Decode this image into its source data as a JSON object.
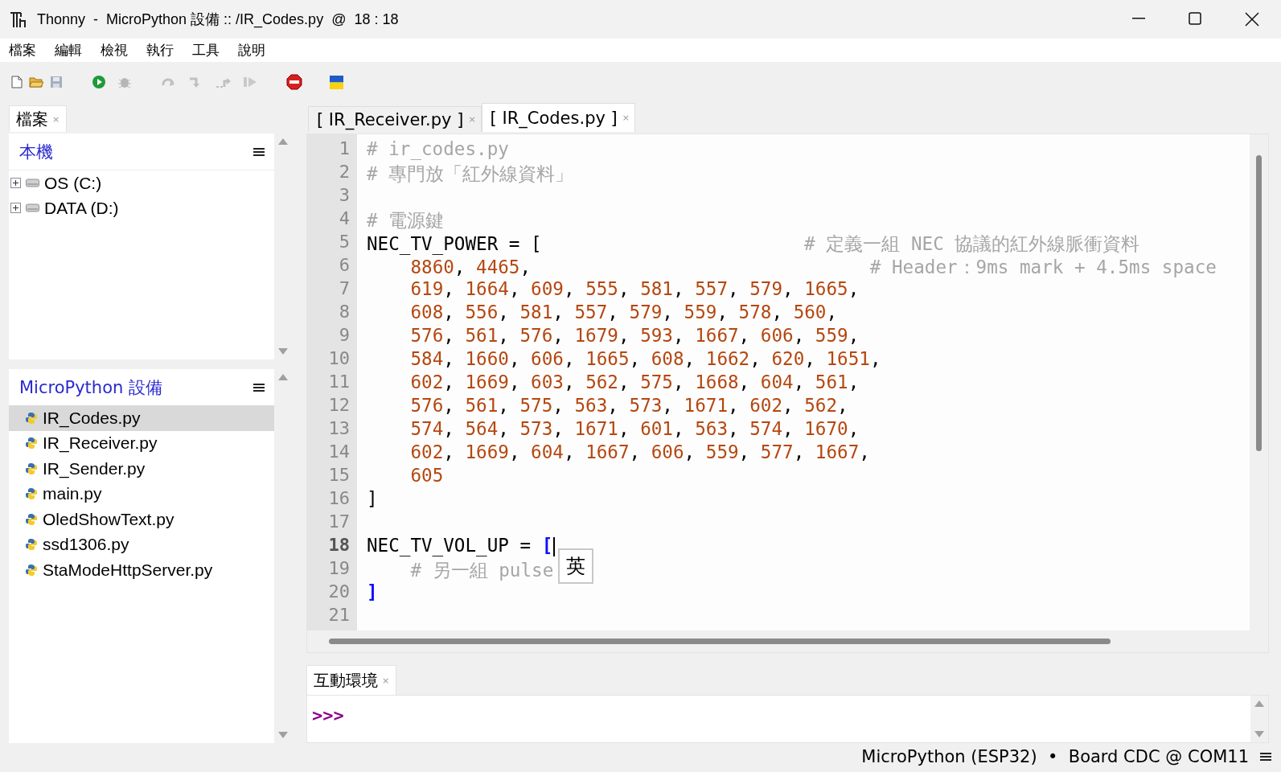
{
  "window": {
    "title": "Thonny  -  MicroPython 設備 :: /IR_Codes.py  @  18 : 18"
  },
  "menu": [
    "檔案",
    "編輯",
    "檢視",
    "執行",
    "工具",
    "說明"
  ],
  "toolbar": [
    {
      "kind": "new",
      "disabled": false
    },
    {
      "kind": "open",
      "disabled": false
    },
    {
      "kind": "save",
      "disabled": true
    },
    {
      "kind": "run",
      "disabled": false
    },
    {
      "kind": "debug",
      "disabled": true
    },
    {
      "kind": "step-over",
      "disabled": true
    },
    {
      "kind": "step-into",
      "disabled": true
    },
    {
      "kind": "step-out",
      "disabled": true
    },
    {
      "kind": "resume",
      "disabled": true
    },
    {
      "kind": "stop",
      "disabled": false
    },
    {
      "kind": "flag",
      "disabled": false
    }
  ],
  "sidebar": {
    "tab": {
      "label": "檔案",
      "close": "×"
    },
    "local": {
      "title": "本機",
      "items": [
        {
          "label": "OS (C:)",
          "expanded": false
        },
        {
          "label": "DATA (D:)",
          "expanded": false
        }
      ]
    },
    "device": {
      "title": "MicroPython 設備",
      "items": [
        {
          "label": "IR_Codes.py",
          "selected": true
        },
        {
          "label": "IR_Receiver.py",
          "selected": false
        },
        {
          "label": "IR_Sender.py",
          "selected": false
        },
        {
          "label": "main.py",
          "selected": false
        },
        {
          "label": "OledShowText.py",
          "selected": false
        },
        {
          "label": "ssd1306.py",
          "selected": false
        },
        {
          "label": "StaModeHttpServer.py",
          "selected": false
        }
      ]
    }
  },
  "editor": {
    "tabs": [
      {
        "label": "[ IR_Receiver.py ]",
        "close": "×",
        "selected": false
      },
      {
        "label": "[ IR_Codes.py ]",
        "close": "×",
        "selected": true
      }
    ],
    "lines": [
      {
        "number": "1",
        "current": false,
        "tokens": [
          {
            "kind": "comment",
            "text": "# ir_codes.py"
          }
        ]
      },
      {
        "number": "2",
        "current": false,
        "tokens": [
          {
            "kind": "comment",
            "text": "# 專門放「紅外線資料」"
          }
        ]
      },
      {
        "number": "3",
        "current": false
      },
      {
        "number": "4",
        "current": false,
        "tokens": [
          {
            "kind": "comment",
            "text": "# 電源鍵"
          }
        ]
      },
      {
        "number": "5",
        "current": false,
        "tokens": [
          {
            "kind": "plain",
            "text": "NEC_TV_POWER = ["
          },
          {
            "kind": "comment",
            "text": "                        # 定義一組 NEC 協議的紅外線脈衝資料"
          }
        ]
      },
      {
        "number": "6",
        "current": false,
        "tokens": [
          {
            "kind": "numbers",
            "text": "    8860, 4465,"
          },
          {
            "kind": "comment",
            "text": "                               # Header：9ms mark + 4.5ms space"
          }
        ]
      },
      {
        "number": "7",
        "current": false,
        "tokens": [
          {
            "kind": "numbers",
            "text": "    619, 1664, 609, 555, 581, 557, 579, 1665,"
          }
        ]
      },
      {
        "number": "8",
        "current": false,
        "tokens": [
          {
            "kind": "numbers",
            "text": "    608, 556, 581, 557, 579, 559, 578, 560,"
          }
        ]
      },
      {
        "number": "9",
        "current": false,
        "tokens": [
          {
            "kind": "numbers",
            "text": "    576, 561, 576, 1679, 593, 1667, 606, 559,"
          }
        ]
      },
      {
        "number": "10",
        "current": false,
        "tokens": [
          {
            "kind": "numbers",
            "text": "    584, 1660, 606, 1665, 608, 1662, 620, 1651,"
          }
        ]
      },
      {
        "number": "11",
        "current": false,
        "tokens": [
          {
            "kind": "numbers",
            "text": "    602, 1669, 603, 562, 575, 1668, 604, 561,"
          }
        ]
      },
      {
        "number": "12",
        "current": false,
        "tokens": [
          {
            "kind": "numbers",
            "text": "    576, 561, 575, 563, 573, 1671, 602, 562,"
          }
        ]
      },
      {
        "number": "13",
        "current": false,
        "tokens": [
          {
            "kind": "numbers",
            "text": "    574, 564, 573, 1671, 601, 563, 574, 1670,"
          }
        ]
      },
      {
        "number": "14",
        "current": false,
        "tokens": [
          {
            "kind": "numbers",
            "text": "    602, 1669, 604, 1667, 606, 559, 577, 1667,"
          }
        ]
      },
      {
        "number": "15",
        "current": false,
        "tokens": [
          {
            "kind": "numbers",
            "text": "    605"
          }
        ]
      },
      {
        "number": "16",
        "current": false,
        "tokens": [
          {
            "kind": "plain",
            "text": "]"
          }
        ]
      },
      {
        "number": "17",
        "current": false
      },
      {
        "number": "18",
        "current": true,
        "tokens": [
          {
            "kind": "plain",
            "text": "NEC_TV_VOL_UP = "
          },
          {
            "kind": "bracket",
            "text": "["
          }
        ]
      },
      {
        "number": "19",
        "current": false,
        "tokens": [
          {
            "kind": "comment",
            "text": "    # 另一組 pulse"
          }
        ]
      },
      {
        "number": "20",
        "current": false,
        "tokens": [
          {
            "kind": "bracket",
            "text": "]"
          }
        ]
      },
      {
        "number": "21",
        "current": false
      }
    ],
    "ime_popup": "英"
  },
  "shell": {
    "tab": {
      "label": "互動環境",
      "close": "×"
    },
    "prompt": ">>>"
  },
  "status_bar": {
    "text": "MicroPython (ESP32)  •  Board CDC @ COM11"
  }
}
